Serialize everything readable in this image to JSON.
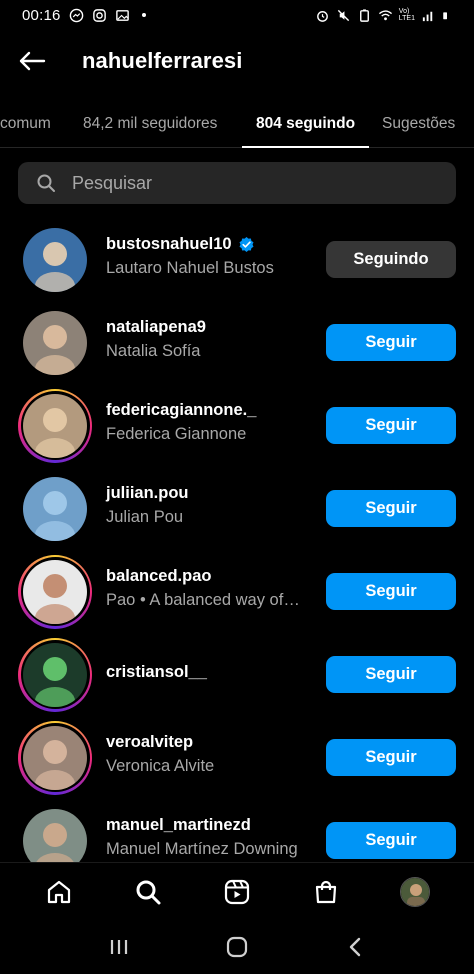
{
  "status_bar": {
    "time": "00:16",
    "network_label": "Vo)\nLTE1"
  },
  "header": {
    "title": "nahuelferraresi"
  },
  "tabs": [
    {
      "label": "comum"
    },
    {
      "label": "84,2 mil seguidores"
    },
    {
      "label": "804 seguindo"
    },
    {
      "label": "Sugestões"
    }
  ],
  "search": {
    "placeholder": "Pesquisar"
  },
  "users": [
    {
      "username": "bustosnahuel10",
      "fullname": "Lautaro Nahuel Bustos",
      "verified": true,
      "story": false,
      "button": "Seguindo",
      "button_style": "following",
      "avatar_bg": "#3a6ea5",
      "avatar_fg": "#d9c7b0"
    },
    {
      "username": "nataliapena9",
      "fullname": "Natalia Sofía",
      "verified": false,
      "story": false,
      "button": "Seguir",
      "button_style": "follow",
      "avatar_bg": "#8d8277",
      "avatar_fg": "#d8b99c"
    },
    {
      "username": "federicagiannone._",
      "fullname": "Federica Giannone",
      "verified": false,
      "story": true,
      "button": "Seguir",
      "button_style": "follow",
      "avatar_bg": "#b39a7e",
      "avatar_fg": "#e2c7a4"
    },
    {
      "username": "juliian.pou",
      "fullname": "Julian Pou",
      "verified": false,
      "story": false,
      "button": "Seguir",
      "button_style": "follow",
      "avatar_bg": "#6f9fc9",
      "avatar_fg": "#9ec7e8"
    },
    {
      "username": "balanced.pao",
      "fullname": "Pao • A balanced way of…",
      "verified": false,
      "story": true,
      "button": "Seguir",
      "button_style": "follow",
      "avatar_bg": "#e9e9e9",
      "avatar_fg": "#c48f74"
    },
    {
      "username": "cristiansol__",
      "fullname": "",
      "verified": false,
      "story": true,
      "button": "Seguir",
      "button_style": "follow",
      "avatar_bg": "#1c3b2a",
      "avatar_fg": "#5fbf6a"
    },
    {
      "username": "veroalvitep",
      "fullname": "Veronica Alvite",
      "verified": false,
      "story": true,
      "button": "Seguir",
      "button_style": "follow",
      "avatar_bg": "#9a8476",
      "avatar_fg": "#d4b39c"
    },
    {
      "username": "manuel_martinezd",
      "fullname": "Manuel Martínez Downing",
      "verified": false,
      "story": false,
      "button": "Seguir",
      "button_style": "follow",
      "avatar_bg": "#7f8e86",
      "avatar_fg": "#c9a88c"
    }
  ],
  "bottom_nav": [
    {
      "icon": "home-icon"
    },
    {
      "icon": "search-icon"
    },
    {
      "icon": "reels-icon"
    },
    {
      "icon": "shop-icon"
    },
    {
      "icon": "profile-avatar"
    }
  ],
  "system_nav": [
    {
      "icon": "recents-icon"
    },
    {
      "icon": "home-circle-icon"
    },
    {
      "icon": "back-chevron-icon"
    }
  ],
  "colors": {
    "accent": "#0095f6",
    "following_button": "#363636",
    "background": "#000000",
    "secondary_text": "#a8a8a8",
    "search_bg": "#262626"
  }
}
